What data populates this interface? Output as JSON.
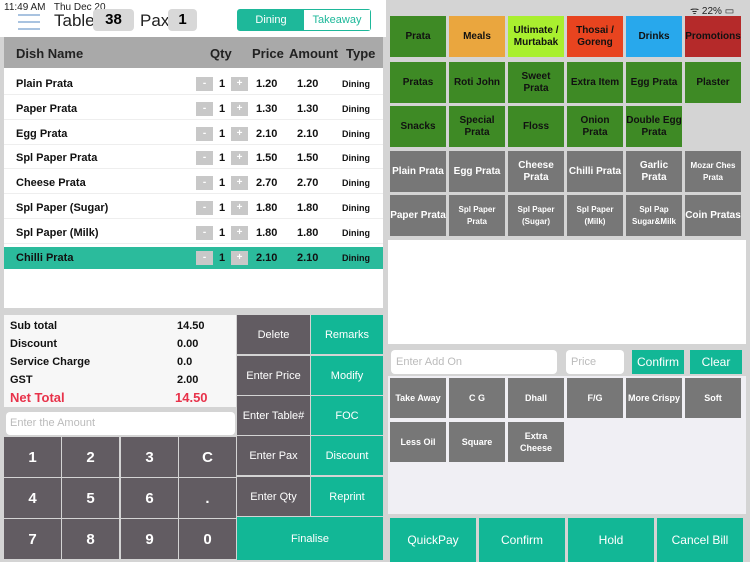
{
  "status": {
    "time": "11:49 AM",
    "date": "Thu Dec 20",
    "battery": "22%"
  },
  "header": {
    "table_label": "Table",
    "table_value": "38",
    "pax_label": "Pax",
    "pax_value": "1",
    "modes": [
      "Dining",
      "Takeaway"
    ],
    "active_mode": "Dining"
  },
  "columns": [
    "Dish Name",
    "Qty",
    "Price",
    "Amount",
    "Type"
  ],
  "orders": [
    {
      "name": "Plain Prata",
      "qty": "1",
      "price": "1.20",
      "amount": "1.20",
      "type": "Dining"
    },
    {
      "name": "Paper Prata",
      "qty": "1",
      "price": "1.30",
      "amount": "1.30",
      "type": "Dining"
    },
    {
      "name": "Egg Prata",
      "qty": "1",
      "price": "2.10",
      "amount": "2.10",
      "type": "Dining"
    },
    {
      "name": "Spl Paper Prata",
      "qty": "1",
      "price": "1.50",
      "amount": "1.50",
      "type": "Dining"
    },
    {
      "name": "Cheese Prata",
      "qty": "1",
      "price": "2.70",
      "amount": "2.70",
      "type": "Dining"
    },
    {
      "name": "Spl Paper (Sugar)",
      "qty": "1",
      "price": "1.80",
      "amount": "1.80",
      "type": "Dining"
    },
    {
      "name": "Spl Paper (Milk)",
      "qty": "1",
      "price": "1.80",
      "amount": "1.80",
      "type": "Dining"
    },
    {
      "name": "Chilli Prata",
      "qty": "1",
      "price": "2.10",
      "amount": "2.10",
      "type": "Dining",
      "selected": true
    }
  ],
  "totals": {
    "subtotal_label": "Sub total",
    "subtotal": "14.50",
    "discount_label": "Discount",
    "discount": "0.00",
    "service_label": "Service Charge",
    "service": "0.0",
    "gst_label": "GST",
    "gst": "2.00",
    "net_label": "Net Total",
    "net": "14.50",
    "net_color": "#e8324a"
  },
  "amount_placeholder": "Enter the Amount",
  "keypad": [
    "1",
    "2",
    "3",
    "C",
    "4",
    "5",
    "6",
    ".",
    "7",
    "8",
    "9",
    "0"
  ],
  "actions": [
    [
      "Delete",
      "Remarks"
    ],
    [
      "Enter Price",
      "Modify"
    ],
    [
      "Enter Table#",
      "FOC"
    ],
    [
      "Enter Pax",
      "Discount"
    ],
    [
      "Enter Qty",
      "Reprint"
    ]
  ],
  "finalise": "Finalise",
  "categories": [
    {
      "label": "Prata",
      "color": "#3e8a25"
    },
    {
      "label": "Meals",
      "color": "#eaa63e"
    },
    {
      "label": "Ultimate / Murtabak",
      "color": "#a9ef2f"
    },
    {
      "label": "Thosai / Goreng",
      "color": "#e8441f"
    },
    {
      "label": "Drinks",
      "color": "#28a8ec"
    },
    {
      "label": "Promotions",
      "color": "#b52a2a"
    }
  ],
  "subcategories": [
    "Pratas",
    "Roti John",
    "Sweet Prata",
    "Extra Item",
    "Egg Prata",
    "Plaster",
    "Snacks",
    "Special Prata",
    "Floss",
    "Onion Prata",
    "Double Egg Prata"
  ],
  "items": [
    "Plain Prata",
    "Egg Prata",
    "Cheese Prata",
    "Chilli Prata",
    "Garlic Prata",
    "Mozar Ches Prata",
    "Paper Prata",
    "Spl Paper Prata",
    "Spl Paper (Sugar)",
    "Spl Paper (Milk)",
    "Spl Pap Sugar&Milk",
    "Coin Pratas"
  ],
  "addon": {
    "placeholder": "Enter Add On",
    "price_placeholder": "Price",
    "confirm": "Confirm",
    "clear": "Clear"
  },
  "modifiers": [
    "Take Away",
    "C G",
    "Dhall",
    "F/G",
    "More Crispy",
    "Soft",
    "Less Oil",
    "Square",
    "Extra Cheese"
  ],
  "bottom": [
    "QuickPay",
    "Confirm",
    "Hold",
    "Cancel Bill"
  ],
  "colors": {
    "accent": "#12b796",
    "green": "#3e8a25",
    "gray_tile": "#777777"
  }
}
